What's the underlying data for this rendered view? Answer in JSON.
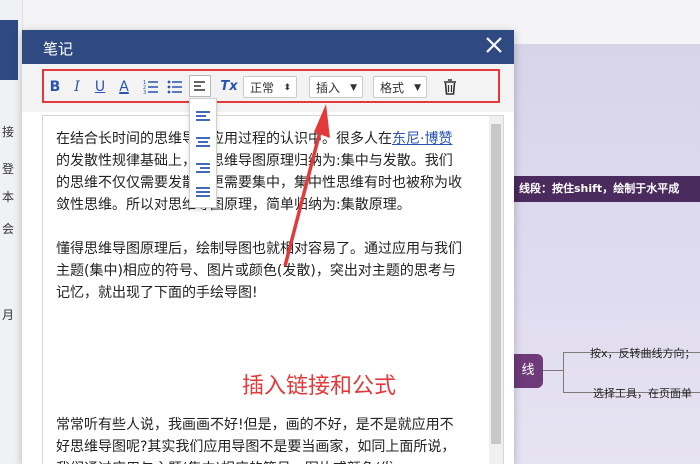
{
  "background": {
    "side_chars": [
      "接",
      "登",
      "本",
      "会",
      "月"
    ],
    "banner_text": "线段：按住shift，绘制于水平成",
    "node_label": "线",
    "mindmap_texts": [
      "按x，反转曲线方向；",
      "选择工具，在页面单"
    ]
  },
  "dialog": {
    "title": "笔记",
    "toolbar": {
      "bold": "B",
      "italic": "I",
      "underline": "U",
      "font_color": "A",
      "clear_format": "Tx",
      "heading_select": "正常",
      "insert_select": "插入",
      "format_select": "格式"
    },
    "content": {
      "p1_before_link": "在结合长时间的思维导图应用过程的认识中。很多人在",
      "p1_link": "东尼·博赞",
      "p1_after": "的发散性规律基础上，把思维导图原理归纳为:集中与发散。我们的思维不仅仅需要发散，更需要集中，集中性思维有时也被称为收敛性思维。所以对思维导图原理，简单归纳为:集散原理。",
      "p2": "懂得思维导图原理后，绘制导图也就相对容易了。通过应用与我们主题(集中)相应的符号、图片或颜色(发散)，突出对主题的思考与记忆，就出现了下面的手绘导图!",
      "p3": "常常听有些人说，我画画不好!但是，画的不好，是不是就应用不好思维导图呢?其实我们应用导图不是要当画家，如同上面所说，我们通过应用与主题(集中)相应的符号、图片或颜色(发"
    },
    "annotation": "插入链接和公式"
  },
  "colors": {
    "titlebar": "#2f4a80",
    "toolbar_icon": "#2a54b0",
    "highlight": "#e23a3a"
  }
}
